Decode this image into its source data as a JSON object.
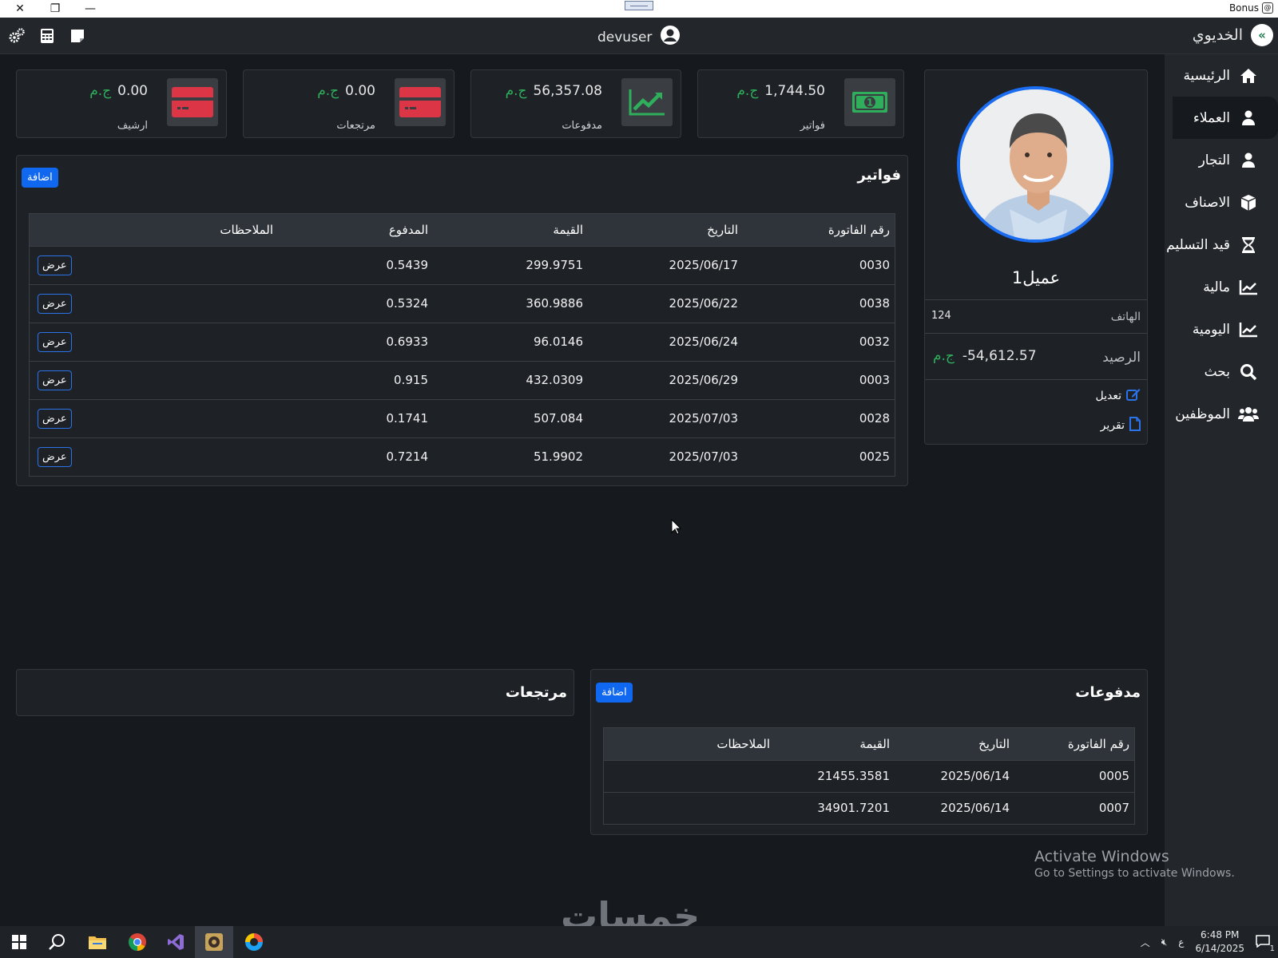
{
  "window": {
    "bonus_label": "Bonus"
  },
  "topbar": {
    "username": "devuser",
    "brand": "الخديوي"
  },
  "sidebar": {
    "items": [
      {
        "label": "الرئيسية",
        "icon": "home-icon"
      },
      {
        "label": "العملاء",
        "icon": "user-icon",
        "active": true
      },
      {
        "label": "التجار",
        "icon": "user-icon"
      },
      {
        "label": "الاصناف",
        "icon": "box-icon"
      },
      {
        "label": "قيد التسليم",
        "icon": "hourglass-icon"
      },
      {
        "label": "مالية",
        "icon": "chart-line-icon"
      },
      {
        "label": "اليومية",
        "icon": "chart-line-icon"
      },
      {
        "label": "بحث",
        "icon": "search-icon"
      },
      {
        "label": "الموظفين",
        "icon": "users-icon"
      }
    ]
  },
  "stats": [
    {
      "amount": "1,744.50",
      "currency": "ج.م",
      "label": "فواتير",
      "icon": "money-bill-icon",
      "color": "#2fae5b"
    },
    {
      "amount": "56,357.08",
      "currency": "ج.م",
      "label": "مدفوعات",
      "icon": "trend-up-icon",
      "color": "#2fae5b"
    },
    {
      "amount": "0.00",
      "currency": "ج.م",
      "label": "مرتجعات",
      "icon": "credit-card-icon",
      "color": "#dc3545"
    },
    {
      "amount": "0.00",
      "currency": "ج.م",
      "label": "ارشيف",
      "icon": "credit-card-icon",
      "color": "#dc3545"
    }
  ],
  "profile": {
    "name": "عميل1",
    "phone_label": "الهاتف",
    "phone": "124",
    "balance_label": "الرصيد",
    "balance": "-54,612.57",
    "currency": "ج.م",
    "edit_label": "تعديل",
    "report_label": "تقرير"
  },
  "invoices": {
    "title": "فواتير",
    "add_label": "اضافة",
    "columns": [
      "رقم الفاتورة",
      "التاريخ",
      "القيمة",
      "المدفوع",
      "الملاحظات"
    ],
    "view_label": "عرض",
    "rows": [
      [
        "0030",
        "2025/06/17",
        "299.9751",
        "0.5439"
      ],
      [
        "0038",
        "2025/06/22",
        "360.9886",
        "0.5324"
      ],
      [
        "0032",
        "2025/06/24",
        "96.0146",
        "0.6933"
      ],
      [
        "0003",
        "2025/06/29",
        "432.0309",
        "0.915"
      ],
      [
        "0028",
        "2025/07/03",
        "507.084",
        "0.1741"
      ],
      [
        "0025",
        "2025/07/03",
        "51.9902",
        "0.7214"
      ]
    ]
  },
  "payments": {
    "title": "مدفوعات",
    "add_label": "اضافة",
    "columns": [
      "رقم الفاتورة",
      "التاريخ",
      "القيمة",
      "الملاحظات"
    ],
    "rows": [
      [
        "0005",
        "2025/06/14",
        "21455.3581"
      ],
      [
        "0007",
        "2025/06/14",
        "34901.7201"
      ]
    ]
  },
  "returns": {
    "title": "مرتجعات"
  },
  "watermark": {
    "line1": "Activate Windows",
    "line2": "Go to Settings to activate Windows."
  },
  "logo_text": "خمسات",
  "taskbar": {
    "lang": "ع",
    "time": "6:48 PM",
    "date": "6/14/2025",
    "notif_count": "1"
  }
}
